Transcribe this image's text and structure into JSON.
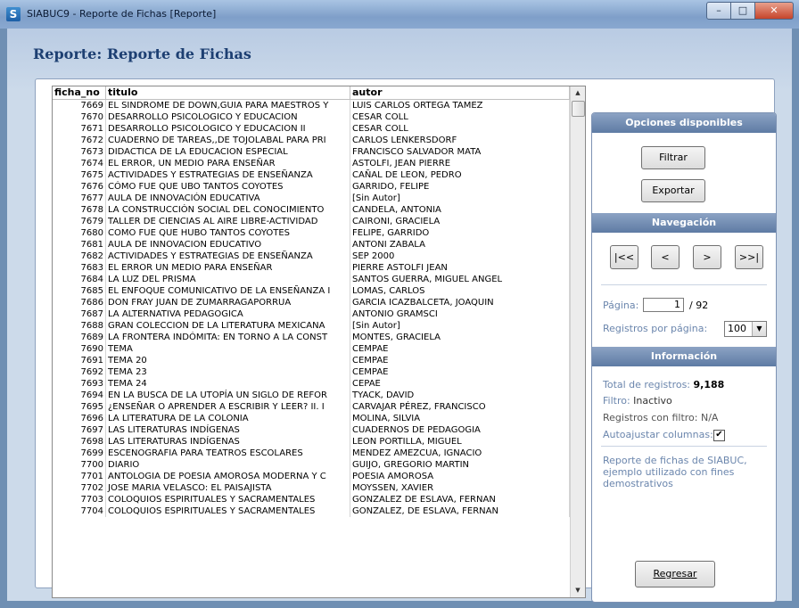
{
  "window": {
    "title": "SIABUC9 - Reporte de Fichas [Reporte]",
    "app_icon": "siabuc-icon",
    "buttons": [
      "minimize",
      "maximize",
      "close"
    ]
  },
  "page": {
    "title": "Reporte: Reporte de Fichas"
  },
  "grid": {
    "columns": [
      "ficha_no",
      "titulo",
      "autor"
    ],
    "rows": [
      [
        "7669",
        "EL SINDROME DE DOWN,GUIA PARA MAESTROS Y",
        "LUIS CARLOS ORTEGA TAMEZ"
      ],
      [
        "7670",
        "DESARROLLO PSICOLOGICO Y EDUCACION",
        "CESAR COLL"
      ],
      [
        "7671",
        "DESARROLLO PSICOLOGICO Y EDUCACION II",
        "CESAR COLL"
      ],
      [
        "7672",
        "CUADERNO DE TAREAS,,DE TOJOLABAL PARA PRI",
        "CARLOS LENKERSDORF"
      ],
      [
        "7673",
        "DIDACTICA DE LA EDUCACION ESPECIAL",
        "FRANCISCO SALVADOR MATA"
      ],
      [
        "7674",
        "EL ERROR, UN MEDIO PARA ENSEÑAR",
        "ASTOLFI, JEAN PIERRE"
      ],
      [
        "7675",
        "ACTIVIDADES Y ESTRATEGIAS DE ENSEÑANZA",
        "CAÑAL DE LEON, PEDRO"
      ],
      [
        "7676",
        "CÓMO FUE QUE UBO TANTOS COYOTES",
        "GARRIDO, FELIPE"
      ],
      [
        "7677",
        "AULA DE INNOVACIÓN EDUCATIVA",
        "[Sin Autor]"
      ],
      [
        "7678",
        "LA CONSTRUCCIÓN SOCIAL DEL CONOCIMIENTO",
        "CANDELA, ANTONIA"
      ],
      [
        "7679",
        "TALLER DE CIENCIAS AL AIRE LIBRE-ACTIVIDAD",
        "CAIRONI, GRACIELA"
      ],
      [
        "7680",
        "COMO FUE QUE HUBO TANTOS COYOTES",
        "FELIPE, GARRIDO"
      ],
      [
        "7681",
        "AULA DE INNOVACION EDUCATIVO",
        "ANTONI ZABALA"
      ],
      [
        "7682",
        "ACTIVIDADES Y ESTRATEGIAS DE ENSEÑANZA",
        "SEP 2000"
      ],
      [
        "7683",
        "EL ERROR UN MEDIO PARA ENSEÑAR",
        "PIERRE ASTOLFI JEAN"
      ],
      [
        "7684",
        "LA LUZ DEL PRISMA",
        "SANTOS GUERRA, MIGUEL ANGEL"
      ],
      [
        "7685",
        "EL ENFOQUE COMUNICATIVO DE LA ENSEÑANZA I",
        "LOMAS, CARLOS"
      ],
      [
        "7686",
        "DON FRAY JUAN DE ZUMARRAGAPORRUA",
        "GARCIA ICAZBALCETA, JOAQUIN"
      ],
      [
        "7687",
        "LA ALTERNATIVA PEDAGOGICA",
        "ANTONIO GRAMSCI"
      ],
      [
        "7688",
        "GRAN COLECCION DE LA LITERATURA MEXICANA",
        "[Sin Autor]"
      ],
      [
        "7689",
        "LA FRONTERA INDÓMITA: EN TORNO A LA CONST",
        "MONTES, GRACIELA"
      ],
      [
        "7690",
        "TEMA",
        "CEMPAE"
      ],
      [
        "7691",
        "TEMA 20",
        "CEMPAE"
      ],
      [
        "7692",
        "TEMA 23",
        "CEMPAE"
      ],
      [
        "7693",
        "TEMA 24",
        "CEPAE"
      ],
      [
        "7694",
        "EN LA BUSCA DE LA UTOPÍA UN SIGLO DE REFOR",
        "TYACK, DAVID"
      ],
      [
        "7695",
        "¿ENSEÑAR O APRENDER A ESCRIBIR Y LEER? II. I",
        "CARVAJAR PÉREZ, FRANCISCO"
      ],
      [
        "7696",
        "LA LITERATURA DE LA COLONIA",
        "MOLINA, SILVIA"
      ],
      [
        "7697",
        "LAS LITERATURAS INDÍGENAS",
        "CUADERNOS DE PEDAGOGIA"
      ],
      [
        "7698",
        "LAS LITERATURAS INDÍGENAS",
        "LEON PORTILLA, MIGUEL"
      ],
      [
        "7699",
        "ESCENOGRAFIA PARA TEATROS ESCOLARES",
        "MENDEZ AMEZCUA, IGNACIO"
      ],
      [
        "7700",
        "DIARIO",
        "GUIJO, GREGORIO MARTIN"
      ],
      [
        "7701",
        "ANTOLOGIA DE POESIA AMOROSA MODERNA Y C",
        "POESIA AMOROSA"
      ],
      [
        "7702",
        "JOSE MARIA VELASCO: EL PAISAJISTA",
        "MOYSSEN, XAVIER"
      ],
      [
        "7703",
        "COLOQUIOS ESPIRITUALES Y SACRAMENTALES",
        "GONZALEZ DE ESLAVA, FERNAN"
      ],
      [
        "7704",
        "COLOQUIOS ESPIRITUALES Y SACRAMENTALES",
        "GONZALEZ, DE ESLAVA, FERNAN"
      ]
    ]
  },
  "sidebar": {
    "options_header": "Opciones disponibles",
    "filter_label": "Filtrar",
    "export_label": "Exportar",
    "nav_header": "Navegación",
    "nav_first": "|<<",
    "nav_prev": "<",
    "nav_next": ">",
    "nav_last": ">>|",
    "page_label": "Página:",
    "page_value": "1",
    "page_total": "/ 92",
    "per_page_label": "Registros por página:",
    "per_page_value": "100",
    "info_header": "Información",
    "total_label": "Total de registros:",
    "total_value": "9,188",
    "filter_state_label": "Filtro:",
    "filter_state_value": "Inactivo",
    "filtered_label": "Registros con filtro:",
    "filtered_value": "N/A",
    "autoadjust_label": "Autoajustar columnas:",
    "autoadjust_checked": true,
    "description": "Reporte de fichas de SIABUC, ejemplo utilizado con fines demostrativos",
    "back_label": "Regresar"
  },
  "colors": {
    "accent": "#5e7ba4",
    "title_blue": "#1d3f72",
    "label_blue": "#6b86ad"
  }
}
